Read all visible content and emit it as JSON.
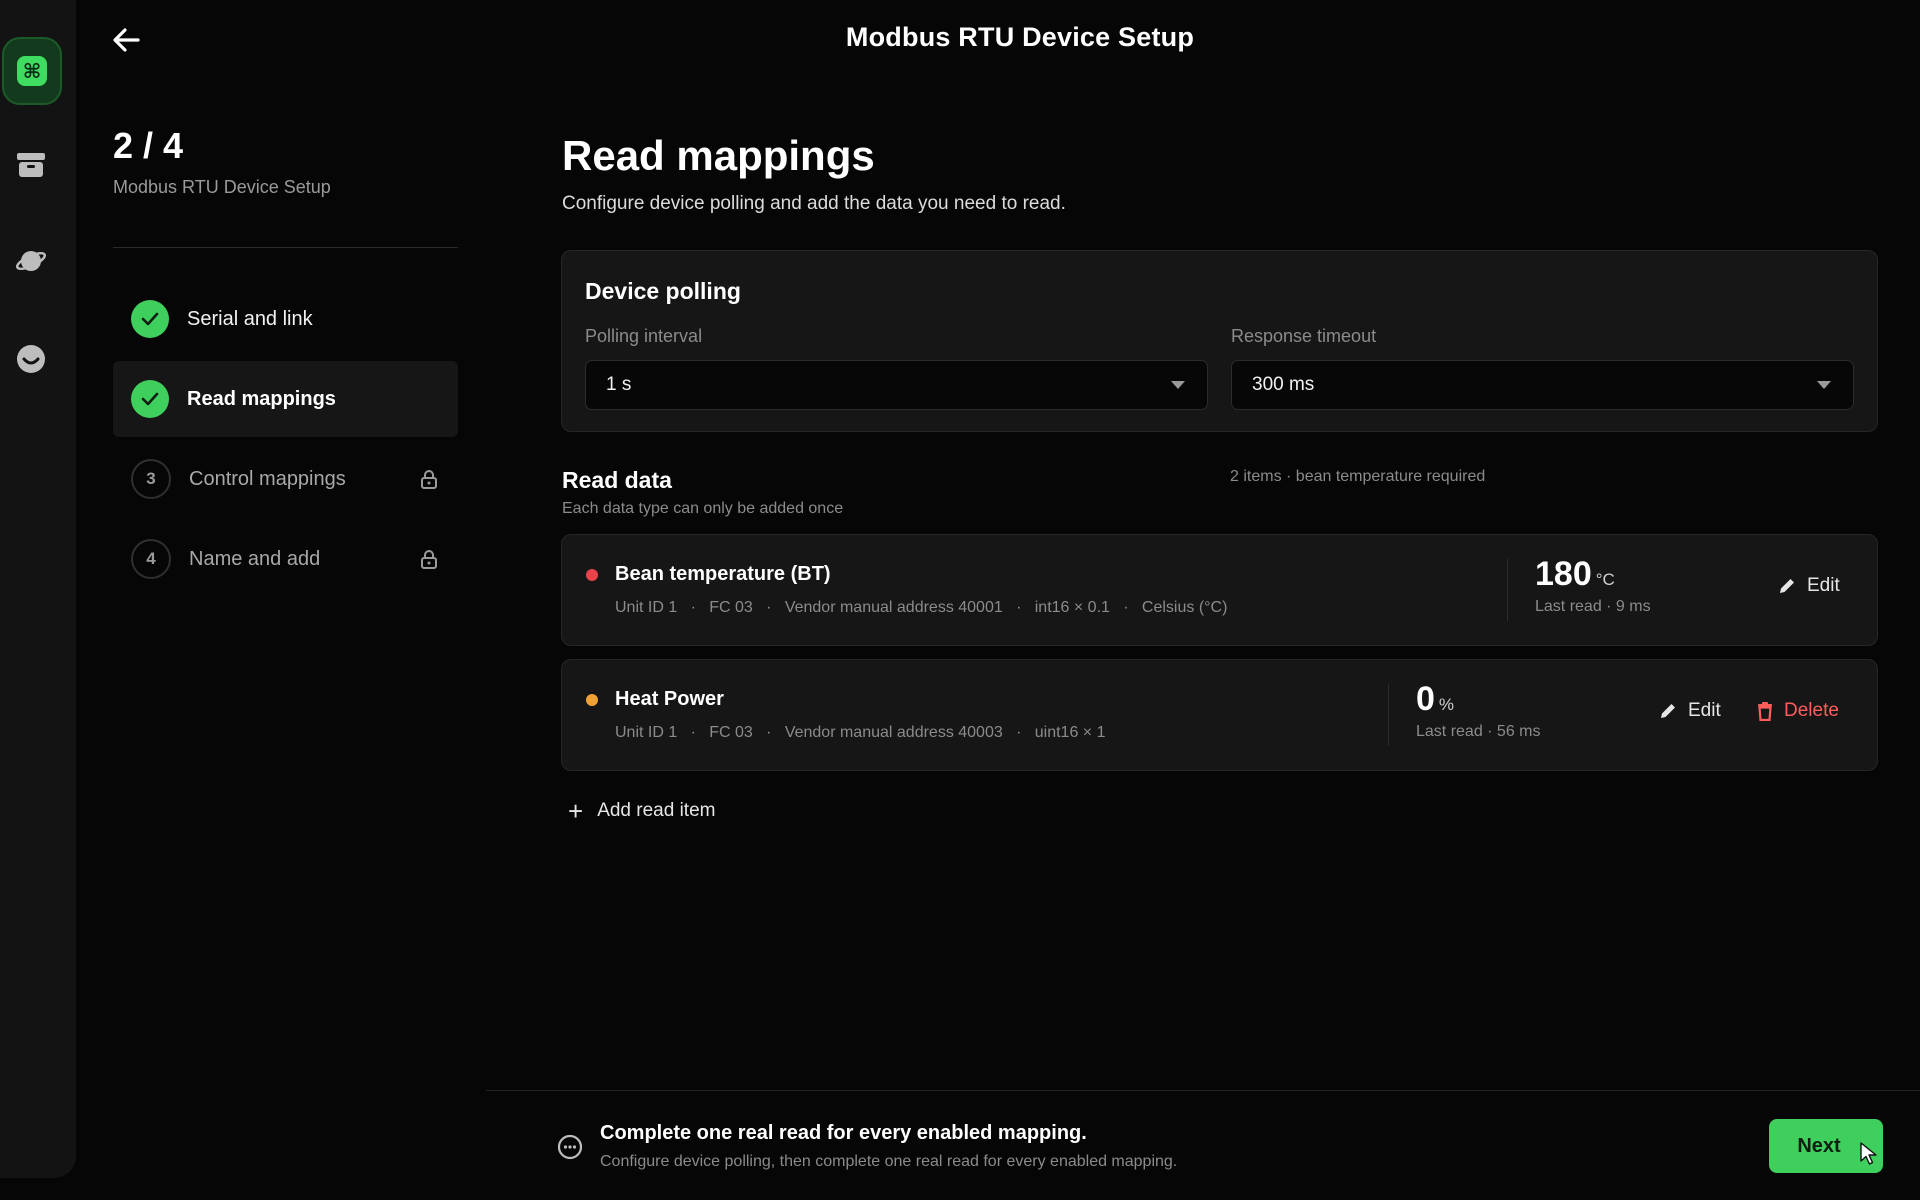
{
  "header": {
    "title": "Modbus RTU Device Setup"
  },
  "steps": {
    "counter": "2 / 4",
    "subtitle": "Modbus RTU Device Setup",
    "items": [
      {
        "label": "Serial and link",
        "state": "done"
      },
      {
        "label": "Read mappings",
        "state": "current"
      },
      {
        "number": "3",
        "label": "Control mappings",
        "state": "locked"
      },
      {
        "number": "4",
        "label": "Name and add",
        "state": "locked"
      }
    ]
  },
  "main": {
    "title": "Read mappings",
    "subtitle": "Configure device polling and add the data you need to read."
  },
  "polling": {
    "title": "Device polling",
    "interval_label": "Polling interval",
    "interval_value": "1 s",
    "timeout_label": "Response timeout",
    "timeout_value": "300 ms"
  },
  "read_data": {
    "title": "Read data",
    "subtitle": "Each data type can only be added once",
    "meta": "2 items · bean temperature required",
    "items": [
      {
        "name": "Bean temperature (BT)",
        "dot_color": "#e8424b",
        "detail": "Unit ID 1   ·   FC 03   ·   Vendor manual address 40001   ·   int16 × 0.1   ·   Celsius (°C)",
        "value": "180",
        "unit": "°C",
        "last_read": "Last read · 9 ms",
        "edit_label": "Edit"
      },
      {
        "name": "Heat Power",
        "dot_color": "#f0a236",
        "detail": "Unit ID 1   ·   FC 03   ·   Vendor manual address 40003   ·   uint16 × 1",
        "value": "0",
        "unit": "%",
        "last_read": "Last read · 56 ms",
        "edit_label": "Edit",
        "delete_label": "Delete"
      }
    ],
    "add_label": "Add read item"
  },
  "footer": {
    "title": "Complete one real read for every enabled mapping.",
    "subtitle": "Configure device polling, then complete one real read for every enabled mapping.",
    "next_label": "Next"
  },
  "colors": {
    "accent": "#3ecf5c",
    "danger": "#ff5c5c",
    "background": "#060606",
    "card": "#161616"
  },
  "icons": [
    "app-logo-icon",
    "archive-icon",
    "planet-icon",
    "smile-icon",
    "back-arrow-icon",
    "check-icon",
    "lock-icon",
    "edit-icon",
    "trash-icon",
    "plus-icon",
    "info-icon",
    "cursor-icon"
  ]
}
